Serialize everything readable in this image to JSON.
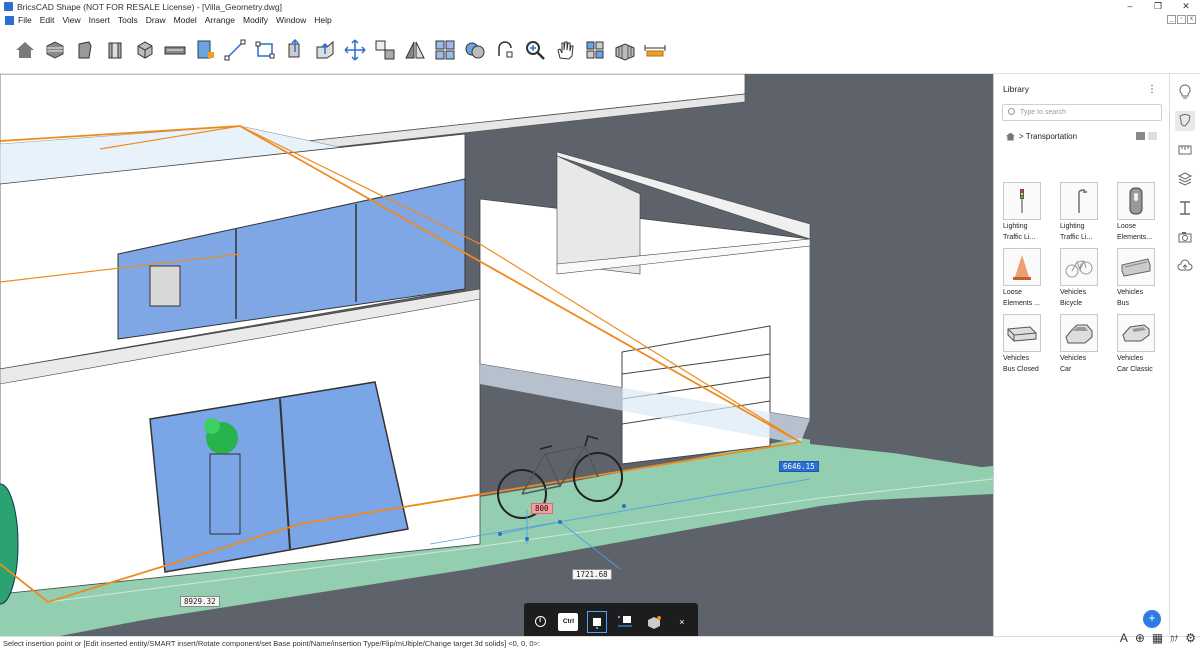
{
  "window": {
    "title": "BricsCAD Shape (NOT FOR RESALE License) - [Villa_Geometry.dwg]"
  },
  "menu": [
    "File",
    "Edit",
    "View",
    "Insert",
    "Tools",
    "Draw",
    "Model",
    "Arrange",
    "Modify",
    "Window",
    "Help"
  ],
  "toolbar_icons": [
    "home-icon",
    "box-stack-icon",
    "cylinder-icon",
    "wall-icon",
    "cube-icon",
    "slab-icon",
    "door-icon",
    "line-icon",
    "rectangle-icon",
    "push-pull-icon",
    "extrude-icon",
    "move-icon",
    "copy-icon",
    "mirror-icon",
    "array-icon",
    "boolean-icon",
    "rotate-icon",
    "zoom-icon",
    "pan-icon",
    "properties-icon",
    "component-icon",
    "dimension-icon"
  ],
  "library": {
    "title": "Library",
    "search_placeholder": "Type to search",
    "breadcrumb": "> Transportation",
    "items": [
      {
        "line1": "Lighting",
        "line2": "Traffic Li...",
        "icon": "traffic-light-icon"
      },
      {
        "line1": "Lighting",
        "line2": "Traffic Li...",
        "icon": "street-lamp-icon"
      },
      {
        "line1": "Loose",
        "line2": "Elements...",
        "icon": "sign-icon"
      },
      {
        "line1": "Loose",
        "line2": "Elements ...",
        "icon": "traffic-cone-icon"
      },
      {
        "line1": "Vehicles",
        "line2": "Bicycle",
        "icon": "bicycle-icon"
      },
      {
        "line1": "Vehicles",
        "line2": "Bus",
        "icon": "bus-icon"
      },
      {
        "line1": "Vehicles",
        "line2": "Bus Closed",
        "icon": "bus-closed-icon"
      },
      {
        "line1": "Vehicles",
        "line2": "Car",
        "icon": "car-icon"
      },
      {
        "line1": "Vehicles",
        "line2": "Car Classic",
        "icon": "car-classic-icon"
      }
    ],
    "add_label": "+"
  },
  "dimensions": {
    "d1": "6646.15",
    "d2": "800",
    "d3": "1721.68",
    "d4": "8929.32"
  },
  "quickbar": {
    "ctrl_label": "Ctrl",
    "close_label": "×"
  },
  "rail_icons": [
    "lightbulb-icon",
    "paint-bucket-icon",
    "ruler-icon",
    "layers-icon",
    "section-icon",
    "camera-icon",
    "cloud-icon"
  ],
  "status": {
    "command_prompt": "Select insertion point or [Edit inserted entity/SMART insert/Rotate component/set Base point/Name/insertion Type/Flip/mUltiple/Change target 3d solids] <0, 0, 0>:",
    "label_a": "A",
    "label_kana": "ｶﾅ"
  },
  "colors": {
    "accent": "#2e7be6",
    "selection": "#f08a1c",
    "floor": "#93ceb0"
  }
}
